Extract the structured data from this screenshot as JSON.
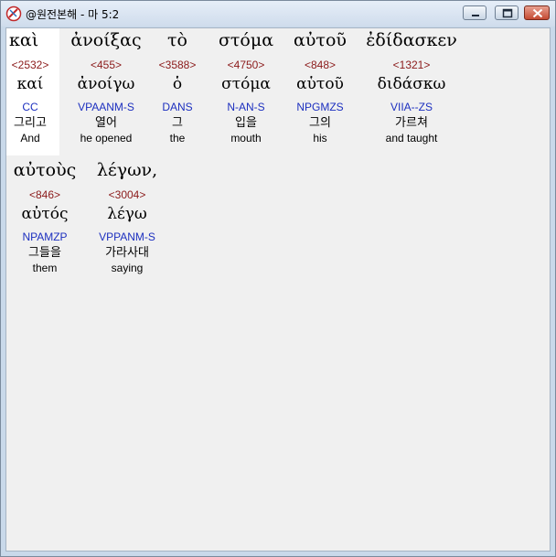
{
  "window": {
    "title": "@원전본해 - 마 5:2",
    "colors": {
      "strong": "#8b1a1a",
      "morph": "#1c2fbf",
      "text": "#000000",
      "background": "#f0f0f0"
    }
  },
  "interlinear": [
    {
      "surface": "καὶ",
      "strong": "<2532>",
      "lemma": "καί",
      "morph": "CC",
      "korean": "그리고",
      "english": "And"
    },
    {
      "surface": "ἀνοίξας",
      "strong": "<455>",
      "lemma": "ἀνοίγω",
      "morph": "VPAANM-S",
      "korean": "열어",
      "english": "he opened"
    },
    {
      "surface": "τὸ",
      "strong": "<3588>",
      "lemma": "ὁ",
      "morph": "DANS",
      "korean": "그",
      "english": "the"
    },
    {
      "surface": "στόμα",
      "strong": "<4750>",
      "lemma": "στόμα",
      "morph": "N-AN-S",
      "korean": "입을",
      "english": "mouth"
    },
    {
      "surface": "αὐτοῦ",
      "strong": "<848>",
      "lemma": "αὑτοῦ",
      "morph": "NPGMZS",
      "korean": "그의",
      "english": "his"
    },
    {
      "surface": "ἐδίδασκεν",
      "strong": "<1321>",
      "lemma": "διδάσκω",
      "morph": "VIIA--ZS",
      "korean": "가르쳐",
      "english": "and taught"
    },
    {
      "surface": "αὐτοὺς",
      "strong": "<846>",
      "lemma": "αὐτός",
      "morph": "NPAMZP",
      "korean": "그들을",
      "english": "them"
    },
    {
      "surface": "λέγων,",
      "strong": "<3004>",
      "lemma": "λέγω",
      "morph": "VPPANM-S",
      "korean": "가라사대",
      "english": "saying"
    }
  ]
}
